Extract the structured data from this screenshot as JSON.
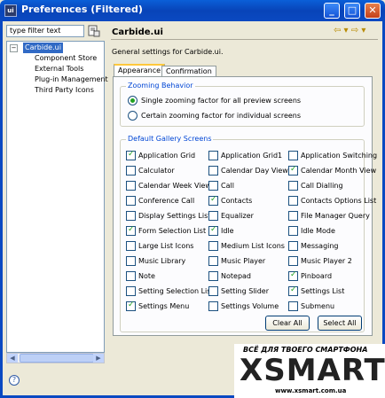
{
  "window": {
    "title": "Preferences (Filtered)",
    "app_icon": "ui",
    "minimize": "_",
    "maximize": "□",
    "close": "✕"
  },
  "sidebar": {
    "filter_placeholder": "type filter text",
    "root": "Carbide.ui",
    "expander": "−",
    "children": [
      "Component Store",
      "External Tools",
      "Plug-in Management",
      "Third Party Icons"
    ]
  },
  "main": {
    "title": "Carbide.ui",
    "description": "General settings for Carbide.ui.",
    "nav": "⇦ ▾ ⇨ ▾",
    "tabs": [
      {
        "label": "Appearance",
        "active": true
      },
      {
        "label": "Confirmation",
        "active": false
      }
    ],
    "zoom_group": {
      "title": "Zooming Behavior",
      "options": [
        {
          "label": "Single zooming factor for all preview screens",
          "selected": true
        },
        {
          "label": "Certain zooming factor for individual screens",
          "selected": false
        }
      ]
    },
    "gallery_group": {
      "title": "Default Gallery Screens",
      "rows": [
        [
          {
            "label": "Application Grid",
            "checked": true
          },
          {
            "label": "Application Grid1",
            "checked": false
          },
          {
            "label": "Application Switching",
            "checked": false
          }
        ],
        [
          {
            "label": "Calculator",
            "checked": false
          },
          {
            "label": "Calendar Day View",
            "checked": false
          },
          {
            "label": "Calendar Month View",
            "checked": true
          }
        ],
        [
          {
            "label": "Calendar Week View",
            "checked": false
          },
          {
            "label": "Call",
            "checked": false
          },
          {
            "label": "Call Dialling",
            "checked": false
          }
        ],
        [
          {
            "label": "Conference Call",
            "checked": false
          },
          {
            "label": "Contacts",
            "checked": true
          },
          {
            "label": "Contacts Options List",
            "checked": false
          }
        ],
        [
          {
            "label": "Display Settings List",
            "checked": false
          },
          {
            "label": "Equalizer",
            "checked": false
          },
          {
            "label": "File Manager Query",
            "checked": false
          }
        ],
        [
          {
            "label": "Form Selection List",
            "checked": true
          },
          {
            "label": "Idle",
            "checked": true
          },
          {
            "label": "Idle Mode",
            "checked": false
          }
        ],
        [
          {
            "label": "Large List Icons",
            "checked": false
          },
          {
            "label": "Medium List Icons",
            "checked": false
          },
          {
            "label": "Messaging",
            "checked": false
          }
        ],
        [
          {
            "label": "Music Library",
            "checked": false
          },
          {
            "label": "Music Player",
            "checked": false
          },
          {
            "label": "Music Player 2",
            "checked": false
          }
        ],
        [
          {
            "label": "Note",
            "checked": false
          },
          {
            "label": "Notepad",
            "checked": false
          },
          {
            "label": "Pinboard",
            "checked": true
          }
        ],
        [
          {
            "label": "Setting Selection List",
            "checked": false
          },
          {
            "label": "Setting Slider",
            "checked": false
          },
          {
            "label": "Settings List",
            "checked": true
          }
        ],
        [
          {
            "label": "Settings Menu",
            "checked": true
          },
          {
            "label": "Settings Volume",
            "checked": false
          },
          {
            "label": "Submenu",
            "checked": false
          }
        ]
      ],
      "clear_all": "Clear All",
      "select_all": "Select All"
    }
  },
  "footer": {
    "help": "?"
  },
  "watermark": {
    "tagline": "ВСЁ ДЛЯ ТВОЕГО СМАРТФОНА",
    "brand": "XSMART",
    "url": "www.xsmart.com.ua"
  }
}
